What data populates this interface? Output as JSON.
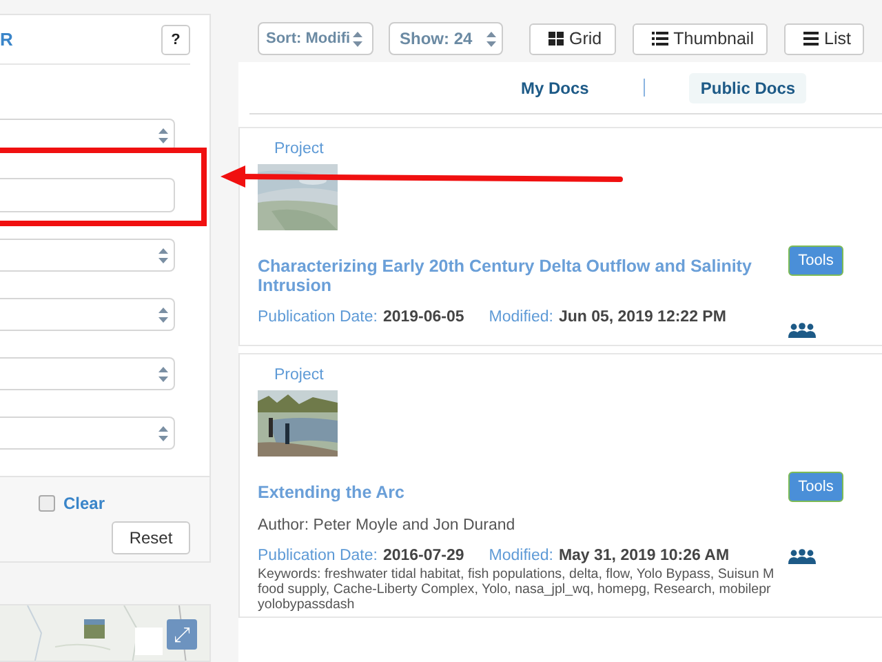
{
  "filter_panel": {
    "title": "R",
    "help_button": "?",
    "fields": [
      {
        "kind": "select"
      },
      {
        "kind": "text"
      },
      {
        "kind": "select"
      },
      {
        "kind": "select"
      },
      {
        "kind": "select"
      },
      {
        "kind": "select"
      }
    ],
    "clear": {
      "label": "Clear",
      "checked": false
    },
    "reset_button": "Reset"
  },
  "map": {
    "kind": "picture",
    "expand_button": "⤢"
  },
  "toolbar": {
    "sort": "Sort: Modifi",
    "show": "Show: 24",
    "views": [
      {
        "label": "Grid"
      },
      {
        "label": "Thumbnail"
      },
      {
        "label": "List"
      }
    ]
  },
  "tabs": [
    {
      "label": "My Docs",
      "selected": false
    },
    {
      "label": "Public Docs",
      "selected": true
    }
  ],
  "results": [
    {
      "type": "Project",
      "title": "Characterizing Early 20th Century Delta Outflow and Salinity Intrusion",
      "publication_label": "Publication Date:",
      "publication_date": "2019-06-05",
      "modified_label": "Modified:",
      "modified": "Jun 05, 2019 12:22 PM",
      "tools_button": "Tools"
    },
    {
      "type": "Project",
      "title": "Extending the Arc",
      "author": "Author: Peter Moyle and Jon Durand",
      "publication_label": "Publication Date:",
      "publication_date": "2016-07-29",
      "modified_label": "Modified:",
      "modified": "May 31, 2019 10:26 AM",
      "keywords": [
        "Keywords: freshwater tidal habitat, fish populations, delta, flow, Yolo Bypass, Suisun M",
        "food supply, Cache-Liberty Complex, Yolo, nasa_jpl_wq, homepg, Research, mobilepr",
        "yolobypassdash"
      ],
      "tools_button": "Tools"
    }
  ]
}
